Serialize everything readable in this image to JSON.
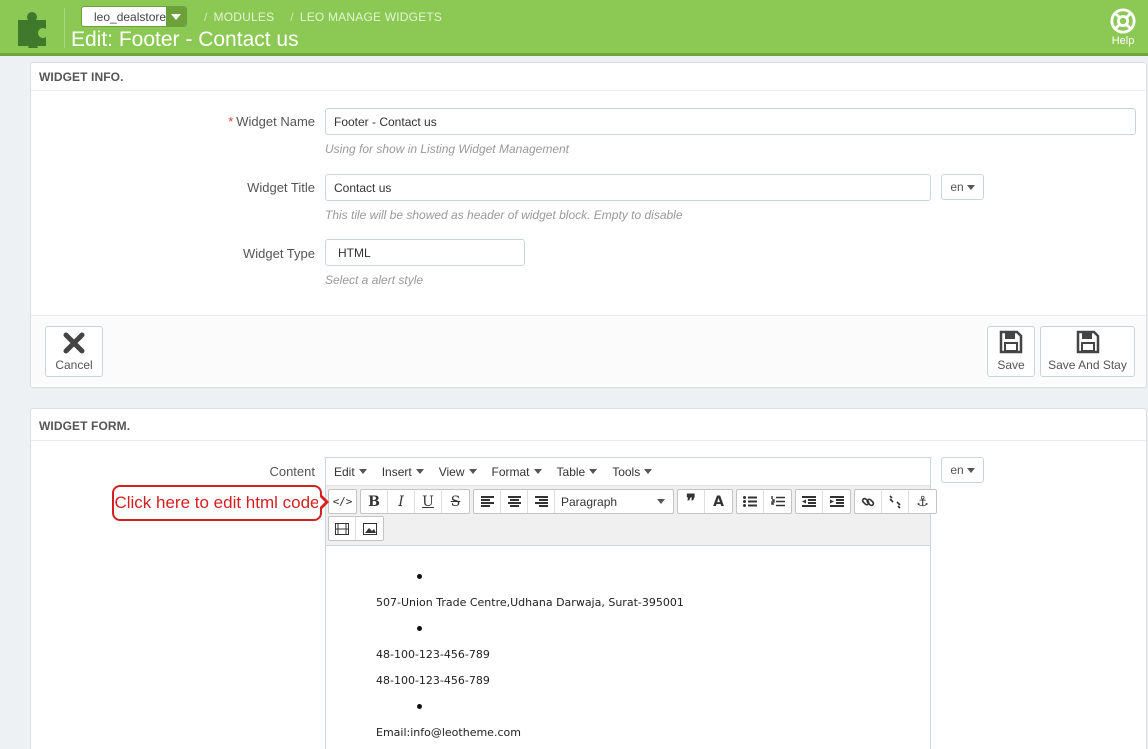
{
  "header": {
    "shop_selector": "leo_dealstore",
    "breadcrumb": [
      "MODULES",
      "LEO MANAGE WIDGETS"
    ],
    "title": "Edit: Footer - Contact us",
    "help_label": "Help"
  },
  "widget_info": {
    "heading": "WIDGET INFO.",
    "widget_name": {
      "label": "Widget Name",
      "required_mark": "*",
      "value": "Footer - Contact us",
      "help": "Using for show in Listing Widget Management"
    },
    "widget_title": {
      "label": "Widget Title",
      "value": "Contact us",
      "lang": "en",
      "help": "This tile will be showed as header of widget block. Empty to disable"
    },
    "widget_type": {
      "label": "Widget Type",
      "value": "HTML",
      "help": "Select a alert style"
    },
    "cancel_label": "Cancel",
    "save_label": "Save",
    "save_stay_label": "Save And Stay"
  },
  "widget_form": {
    "heading": "WIDGET FORM.",
    "content_label": "Content",
    "lang": "en",
    "menu": [
      "Edit",
      "Insert",
      "View",
      "Format",
      "Table",
      "Tools"
    ],
    "format_select": "Paragraph",
    "content_lines": [
      "507-Union Trade Centre,Udhana Darwaja, Surat-395001",
      "48-100-123-456-789",
      "48-100-123-456-789",
      "Email:info@leotheme.com"
    ]
  },
  "annotation": "Click here to edit html code",
  "colors": {
    "header_green": "#8bc954",
    "annotation_red": "#d42020"
  }
}
